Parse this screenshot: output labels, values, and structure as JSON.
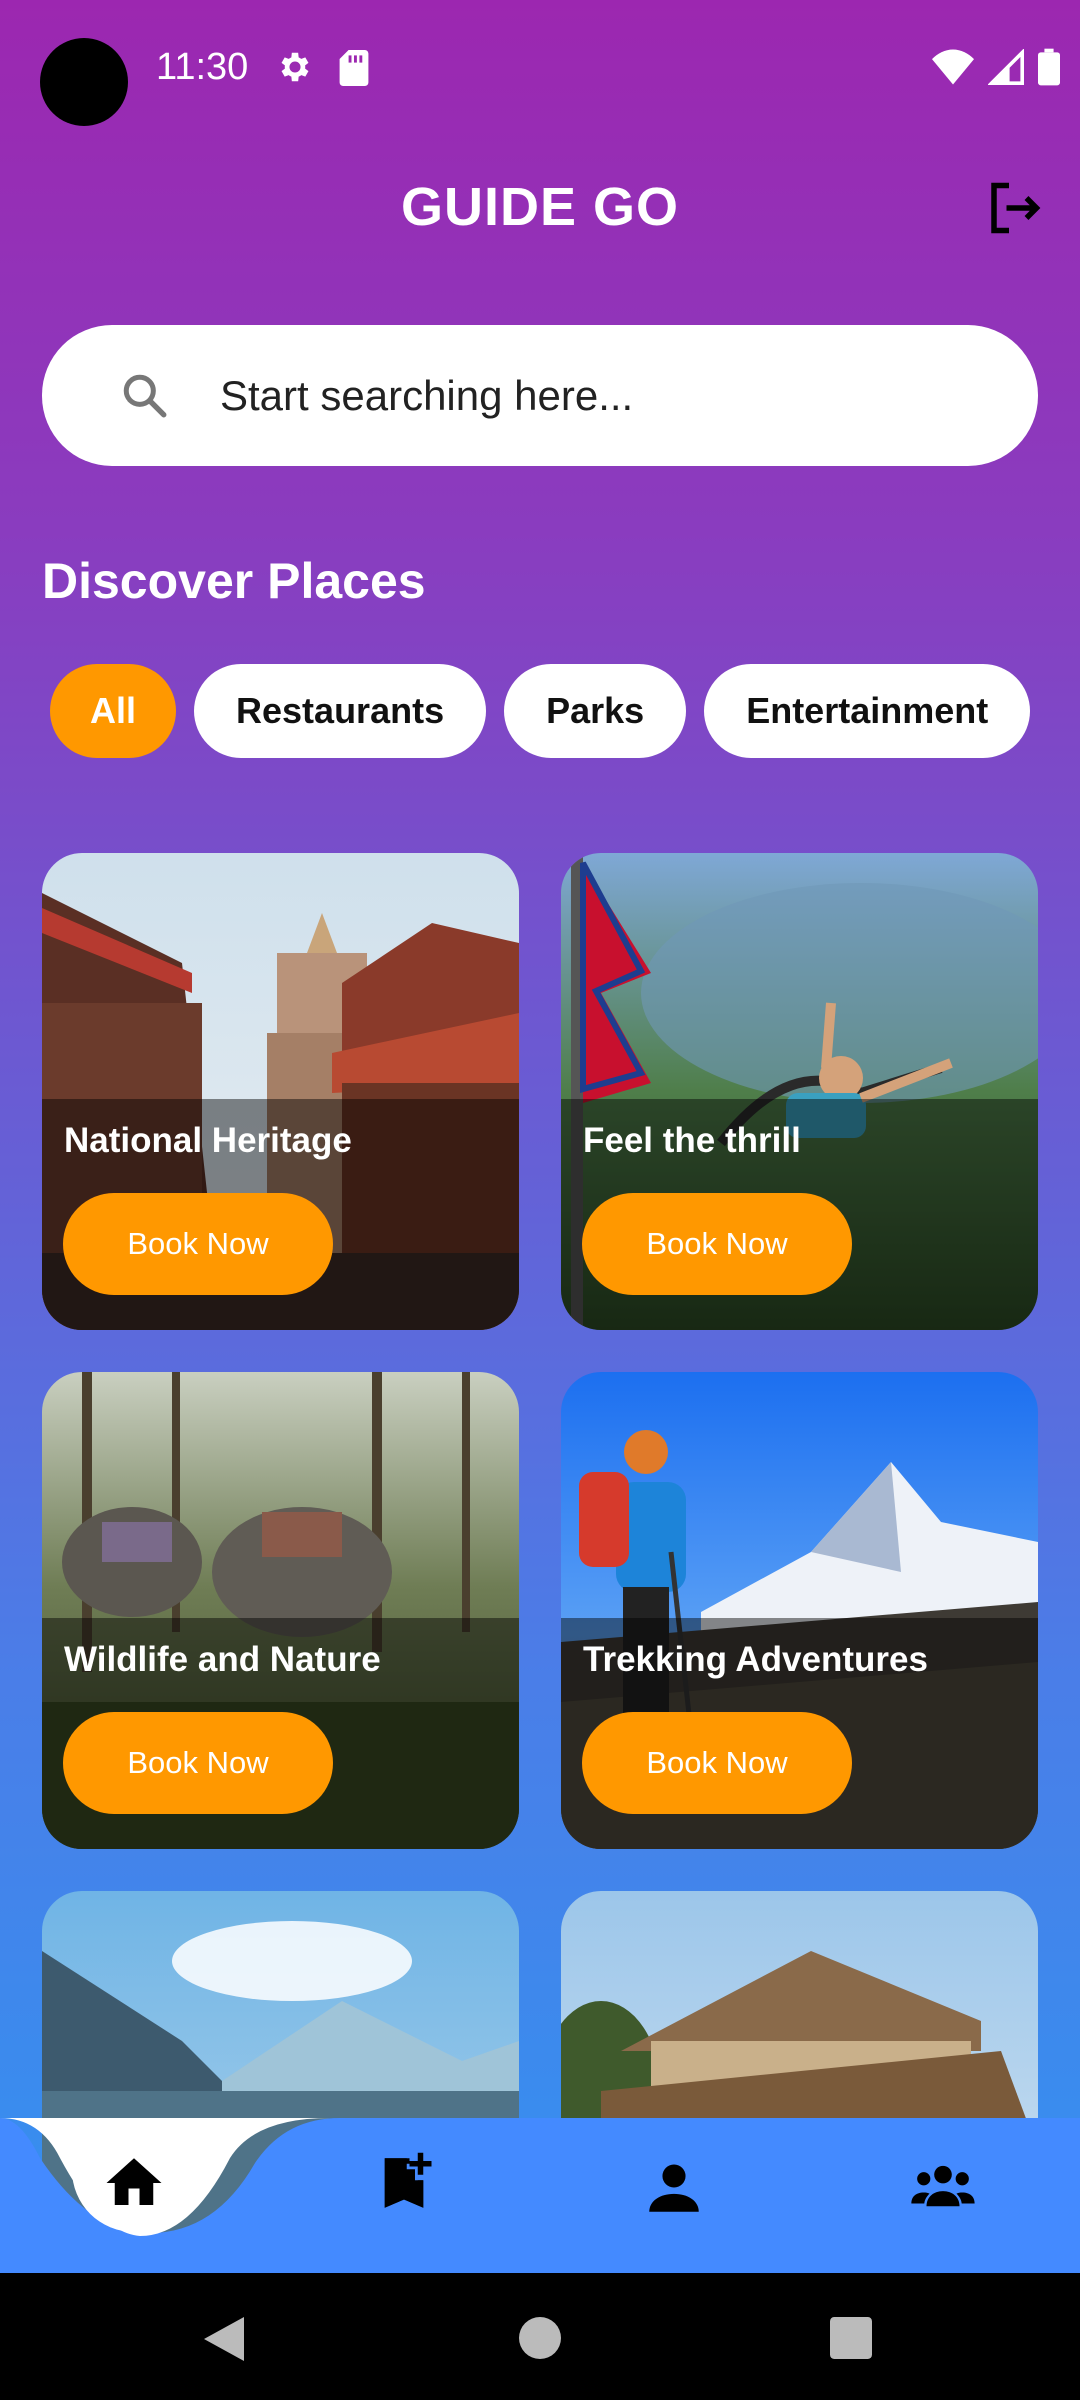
{
  "status_bar": {
    "time": "11:30"
  },
  "header": {
    "title": "GUIDE GO"
  },
  "search": {
    "placeholder": "Start searching here..."
  },
  "section": {
    "title": "Discover Places"
  },
  "filters": [
    {
      "label": "All",
      "active": true
    },
    {
      "label": "Restaurants",
      "active": false
    },
    {
      "label": "Parks",
      "active": false
    },
    {
      "label": "Entertainment",
      "active": false
    }
  ],
  "cards": [
    {
      "title": "National Heritage",
      "button": "Book Now"
    },
    {
      "title": "Feel the thrill",
      "button": "Book Now"
    },
    {
      "title": "Wildlife and Nature",
      "button": "Book Now"
    },
    {
      "title": "Trekking Adventures",
      "button": "Book Now"
    }
  ],
  "bottom_nav": {
    "items": [
      "home-icon",
      "bookmark-add-icon",
      "person-icon",
      "group-icon"
    ],
    "active": "home-icon"
  },
  "colors": {
    "accent": "#ff9800",
    "nav_bar": "#448aff",
    "gradient_top": "#9c27b0",
    "gradient_bottom": "#2f95f2"
  }
}
